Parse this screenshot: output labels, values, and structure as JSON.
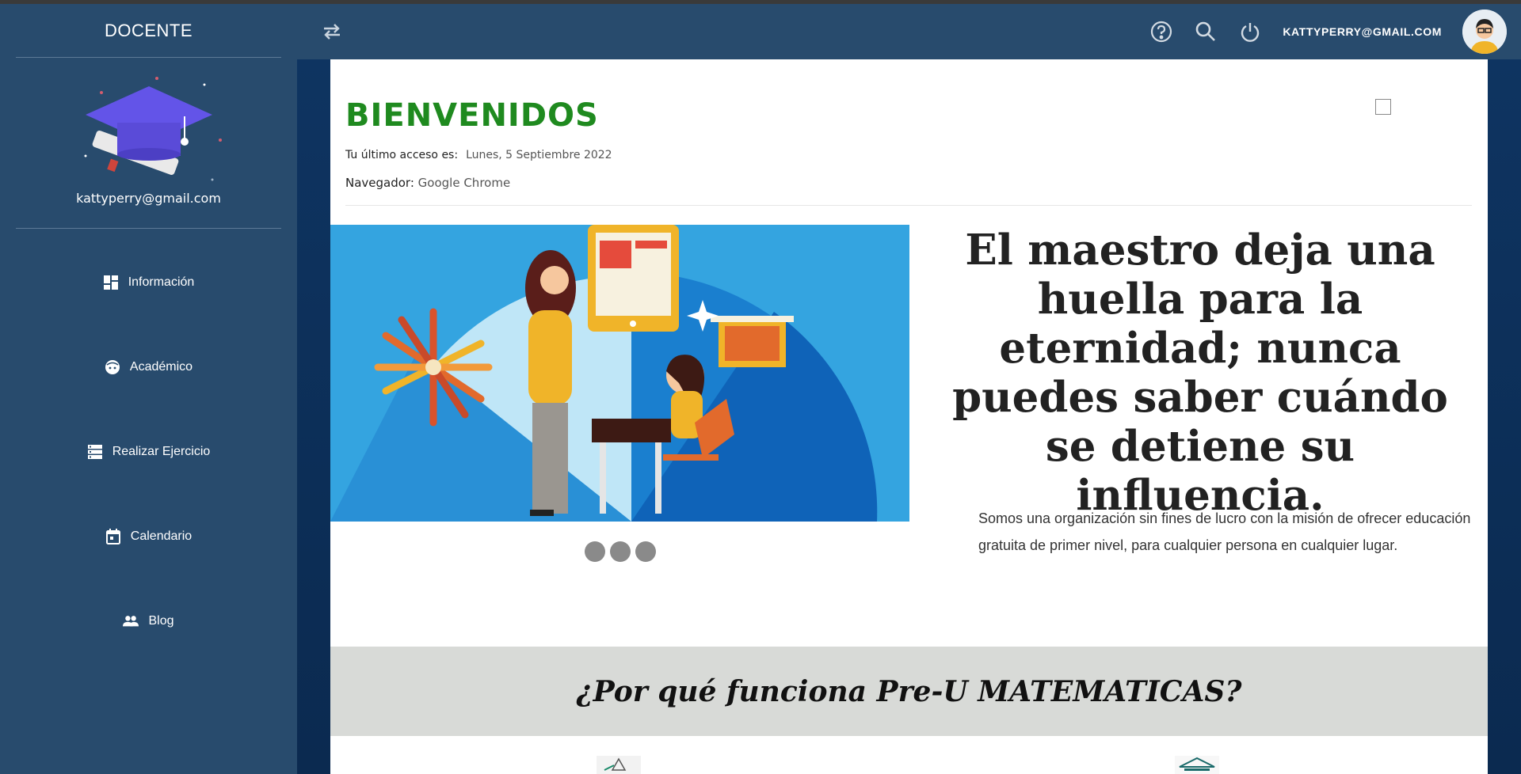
{
  "sidebar": {
    "title": "DOCENTE",
    "email": "kattyperry@gmail.com",
    "items": [
      {
        "label": "Información",
        "icon": "dashboard-icon"
      },
      {
        "label": "Académico",
        "icon": "face-icon"
      },
      {
        "label": "Realizar Ejercicio",
        "icon": "storage-icon"
      },
      {
        "label": "Calendario",
        "icon": "calendar-icon"
      },
      {
        "label": "Blog",
        "icon": "people-icon"
      }
    ]
  },
  "header": {
    "user_email": "KATTYPERRY@GMAIL.COM",
    "icons": [
      "swap-icon",
      "help-icon",
      "search-icon",
      "power-icon"
    ]
  },
  "main": {
    "welcome_title": "BIENVENIDOS",
    "last_access_label": "Tu último acceso es:",
    "last_access_value": "Lunes, 5 Septiembre 2022",
    "browser_label": "Navegador:",
    "browser_value": "Google Chrome",
    "quote": "El maestro deja una huella para la eternidad; nunca puedes saber cuándo se detiene su influencia.",
    "mission": "Somos una organización sin fines de lucro con la misión de ofrecer educación gratuita de primer nivel, para cualquier persona en cualquier lugar.",
    "band_title": "¿Por qué funciona Pre-U MATEMATICAS?"
  },
  "colors": {
    "sidebar_bg": "#284b6d",
    "title_green": "#1f8a1f",
    "band_gray": "#d8dad7"
  }
}
